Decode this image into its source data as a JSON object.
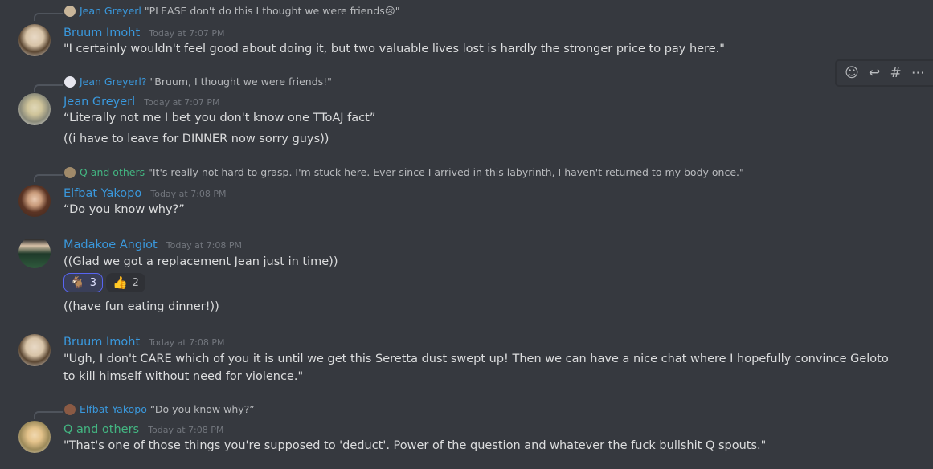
{
  "hover_toolbar": {
    "add_reaction_icon": "add-reaction",
    "reply_icon": "reply",
    "thread_icon": "thread",
    "more_icon": "more"
  },
  "messages": [
    {
      "reply_to": {
        "name": "Jean Greyerl",
        "text": "\"PLEASE don't do this I thought we were friends😢\""
      },
      "author": "Bruum Imoht",
      "timestamp": "Today at 7:07 PM",
      "lines": [
        "\"I certainly wouldn't feel good about doing it, but two valuable lives lost is hardly the stronger price to pay here.\""
      ]
    },
    {
      "reply_to": {
        "name": "Jean Greyerl?",
        "text": "\"Bruum, I thought we were friends!\""
      },
      "author": "Jean Greyerl",
      "timestamp": "Today at 7:07 PM",
      "lines": [
        "“Literally not me I bet you don't know one TToAJ fact”",
        "((i have to leave for DINNER now sorry guys))"
      ]
    },
    {
      "reply_to": {
        "name": "Q and others",
        "text": "\"It's really not hard to grasp. I'm stuck here. Ever since I arrived in this labyrinth, I haven't returned to my body once.\""
      },
      "author": "Elfbat Yakopo",
      "timestamp": "Today at 7:08 PM",
      "lines": [
        "“Do you know why?”"
      ]
    },
    {
      "author": "Madakoe Angiot",
      "timestamp": "Today at 7:08 PM",
      "lines": [
        "((Glad we got a replacement Jean just in time))",
        "((have fun eating dinner!))"
      ],
      "reactions": [
        {
          "emoji": "🐐",
          "count": "3"
        },
        {
          "emoji": "👍",
          "count": "2"
        }
      ]
    },
    {
      "author": "Bruum Imoht",
      "timestamp": "Today at 7:08 PM",
      "lines": [
        "\"Ugh, I don't CARE which of you it is until we get this Seretta dust swept up! Then we can have a nice chat where I hopefully convince Geloto to kill himself without need for violence.\""
      ]
    },
    {
      "reply_to": {
        "name": "Elfbat Yakopo",
        "text": "“Do you know why?”"
      },
      "author": "Q and others",
      "timestamp": "Today at 7:08 PM",
      "lines": [
        "\"That's one of those things you're supposed to 'deduct'. Power of the question and whatever the fuck bullshit Q spouts.\""
      ]
    }
  ]
}
